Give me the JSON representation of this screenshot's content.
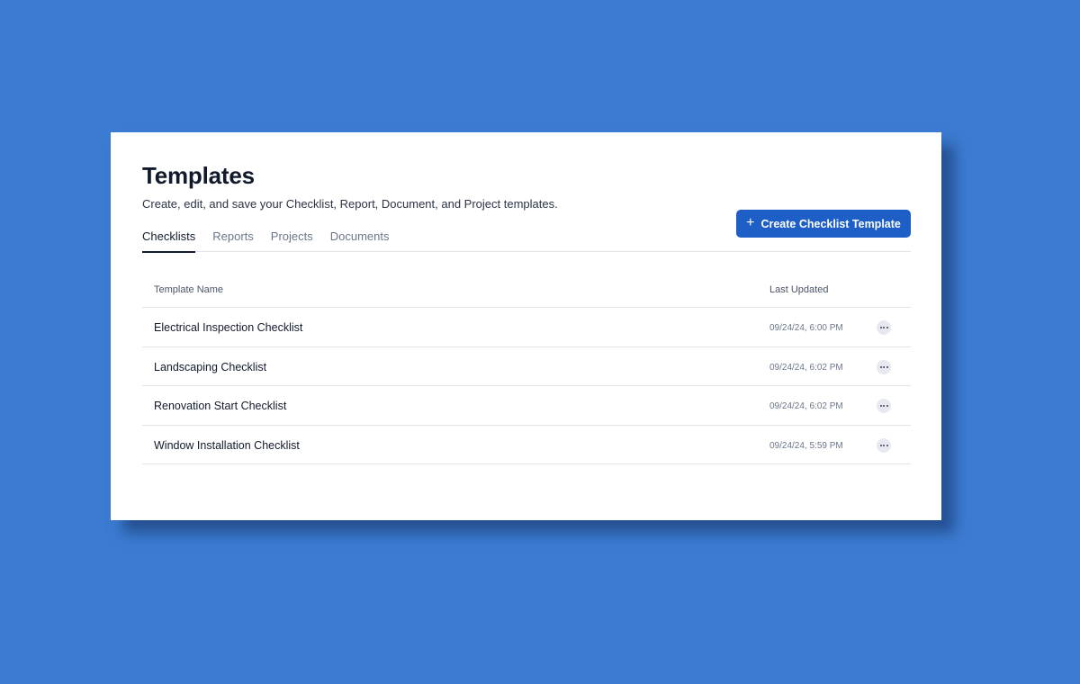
{
  "header": {
    "title": "Templates",
    "subtitle": "Create, edit, and save your Checklist, Report, Document, and Project templates."
  },
  "create_button": {
    "icon": "plus-icon",
    "label": "Create Checklist Template"
  },
  "tabs": [
    {
      "label": "Checklists",
      "active": true
    },
    {
      "label": "Reports",
      "active": false
    },
    {
      "label": "Projects",
      "active": false
    },
    {
      "label": "Documents",
      "active": false
    }
  ],
  "table": {
    "columns": [
      "Template Name",
      "Last Updated"
    ],
    "rows": [
      {
        "name": "Electrical Inspection Checklist",
        "updated": "09/24/24, 6:00 PM"
      },
      {
        "name": "Landscaping Checklist",
        "updated": "09/24/24, 6:02 PM"
      },
      {
        "name": "Renovation Start Checklist",
        "updated": "09/24/24, 6:02 PM"
      },
      {
        "name": "Window Installation Checklist",
        "updated": "09/24/24, 5:59 PM"
      }
    ]
  },
  "colors": {
    "background": "#3b7bd1",
    "accent": "#1d5fc7",
    "text": "#111a2c",
    "muted": "#6b778a"
  }
}
